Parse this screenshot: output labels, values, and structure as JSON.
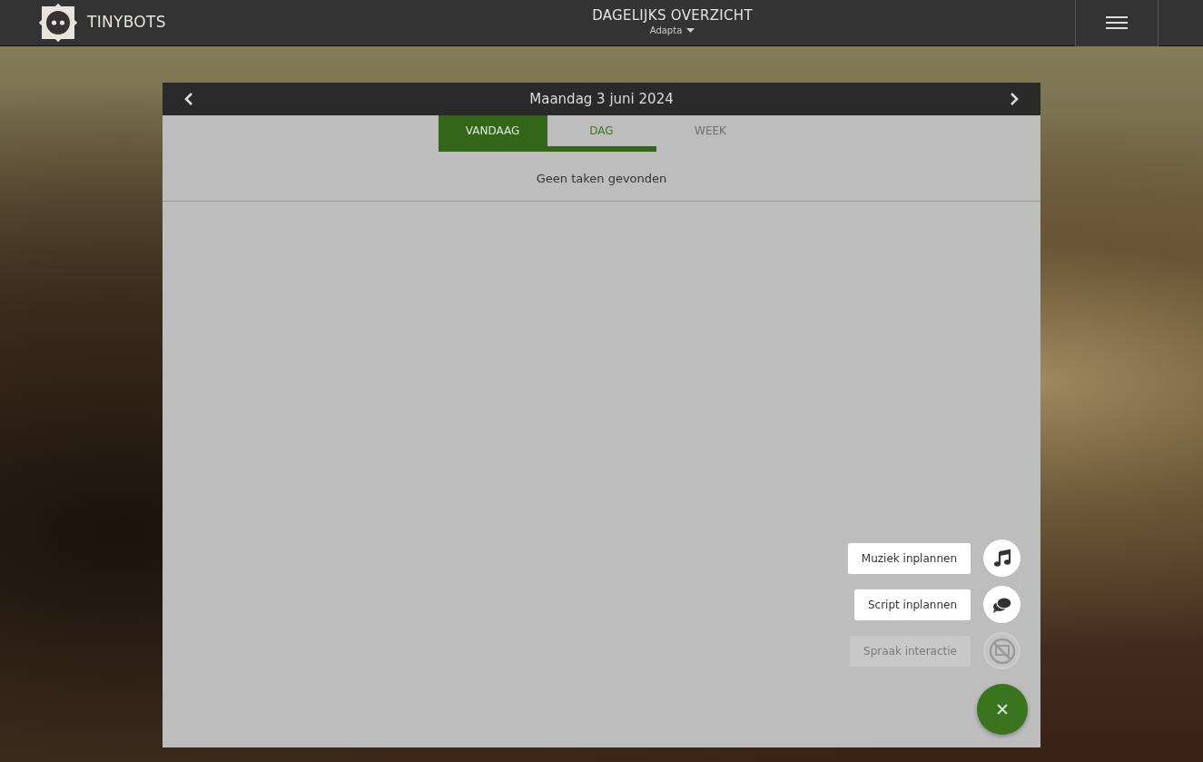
{
  "brand": {
    "name": "TINYBOTS"
  },
  "header": {
    "title": "DAGELIJKS OVERZICHT",
    "subtitle": "Adapta"
  },
  "calendar": {
    "date": "Maandag 3 juni 2024",
    "today_button": {
      "label": "VANDAAG"
    },
    "tabs": [
      {
        "label": "DAG",
        "selected": true
      },
      {
        "label": "WEEK",
        "selected": false
      }
    ],
    "empty_message": "Geen taken gevonden"
  },
  "actions": [
    {
      "label": "Muziek inplannen",
      "kind": "music",
      "disabled": false
    },
    {
      "label": "Script inplannen",
      "kind": "script",
      "disabled": false
    },
    {
      "label": "Spraak interactie",
      "kind": "speech",
      "disabled": true
    }
  ]
}
